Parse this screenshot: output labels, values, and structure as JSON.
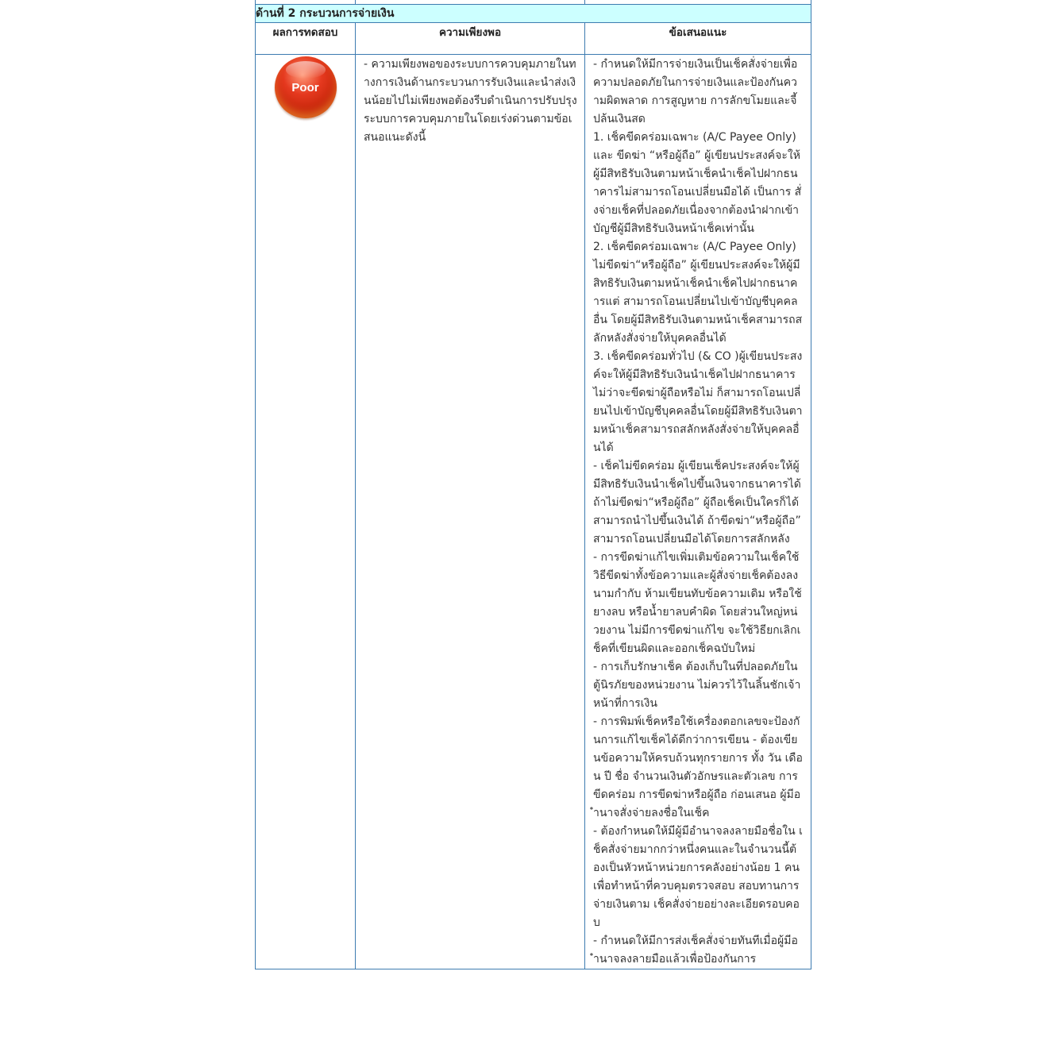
{
  "section_title": "ด้านที่ 2 กระบวนการจ่ายเงิน",
  "headers": {
    "result": "ผลการทดสอบ",
    "adequacy": "ความเพียงพอ",
    "recommendation": "ข้อเสนอแนะ"
  },
  "rating": {
    "label": "Poor",
    "color": "#d32f10"
  },
  "adequacy_text": "- ความเพียงพอของระบบการควบคุมภายในทางการเงินด้านกระบวนการรับเงินและนำส่งเงินน้อยไปไม่เพียงพอต้องรีบดำเนินการปรับปรุงระบบการควบคุมภายในโดยเร่งด่วนตามข้อเสนอแนะดังนี้",
  "recommendations": [
    "- กำหนดให้มีการจ่ายเงินเป็นเช็คสั่งจ่ายเพื่อความปลอดภัยในการจ่ายเงินและป้องกันความผิดพลาด การสูญหาย การลักขโมยและจี้ปล้นเงินสด",
    "1. เช็คขีดคร่อมเฉพาะ (A/C Payee Only) และ ขีดฆ่า “หรือผู้ถือ” ผู้เขียนประสงค์จะให้ผู้มีสิทธิรับเงินตามหน้าเช็คนำเช็คไปฝากธนาคารไม่สามารถโอนเปลี่ยนมือได้ เป็นการ สั่งจ่ายเช็คที่ปลอดภัยเนื่องจากต้องนำฝากเข้าบัญชีผู้มีสิทธิรับเงินหน้าเช็คเท่านั้น",
    "2. เช็คขีดคร่อมเฉพาะ (A/C Payee Only) ไม่ขีดฆ่า“หรือผู้ถือ” ผู้เขียนประสงค์จะให้ผู้มีสิทธิรับเงินตามหน้าเช็คนำเช็คไปฝากธนาคารแต่ สามารถโอนเปลี่ยนไปเข้าบัญชีบุคคลอื่น โดยผู้มีสิทธิรับเงินตามหน้าเช็คสามารถสลักหลังสั่งจ่ายให้บุคคลอื่นได้",
    "3. เช็คขีดคร่อมทั่วไป (& CO )ผู้เขียนประสงค์จะให้ผู้มีสิทธิรับเงินนำเช็คไปฝากธนาคาร ไม่ว่าจะขีดฆ่าผู้ถือหรือไม่ ก็สามารถโอนเปลี่ยนไปเข้าบัญชีบุคคลอื่นโดยผู้มีสิทธิรับเงินตามหน้าเช็คสามารถสลักหลังสั่งจ่ายให้บุคคลอื่นได้",
    "- เช็คไม่ขีดคร่อม ผู้เขียนเช็คประสงค์จะให้ผู้มีสิทธิรับเงินนำเช็คไปขึ้นเงินจากธนาคารได้ ถ้าไม่ขีดฆ่า“หรือผู้ถือ” ผู้ถือเช็คเป็นใครก็ได้สามารถนำไปขึ้นเงินได้ ถ้าขีดฆ่า“หรือผู้ถือ” สามารถโอนเปลี่ยนมือได้โดยการสลักหลัง",
    "- การขีดฆ่าแก้ไขเพิ่มเติมข้อความในเช็คใช้วิธีขีดฆ่าทั้งข้อความและผู้สั่งจ่ายเช็คต้องลงนามกำกับ ห้ามเขียนทับข้อความเดิม หรือใช้ยางลบ หรือน้ำยาลบคำผิด โดยส่วนใหญ่หน่วยงาน ไม่มีการขีดฆ่าแก้ไข จะใช้วิธียกเลิกเช็คที่เขียนผิดและออกเช็คฉบับใหม่",
    "- การเก็บรักษาเช็ค ต้องเก็บในที่ปลอดภัยในตู้นิรภัยของหน่วยงาน ไม่ควรไว้ในลิ้นชักเจ้าหน้าที่การเงิน",
    "- การพิมพ์เช็คหรือใช้เครื่องตอกเลขจะป้องกันการแก้ไขเช็คได้ดีกว่าการเขียน - ต้องเขียนข้อความให้ครบถ้วนทุกรายการ ทั้ง วัน เดือน ปี ชื่อ จำนวนเงินตัวอักษรและตัวเลข การขีดคร่อม การขีดฆ่าหรือผู้ถือ ก่อนเสนอ ผู้มีอำนาจสั่งจ่ายลงชื่อในเช็ค",
    "- ต้องกำหนดให้มีผู้มีอำนาจลงลายมือชื่อใน เช็คสั่งจ่ายมากกว่าหนึ่งคนและในจำนวนนี้ต้องเป็นหัวหน้าหน่วยการคลังอย่างน้อย 1 คนเพื่อทำหน้าที่ควบคุมตรวจสอบ สอบทานการจ่ายเงินตาม เช็คสั่งจ่ายอย่างละเอียดรอบคอบ",
    "- กำหนดให้มีการส่งเช็คสั่งจ่ายทันทีเมื่อผู้มีอำนาจลงลายมือแล้วเพื่อป้องกันการ"
  ]
}
